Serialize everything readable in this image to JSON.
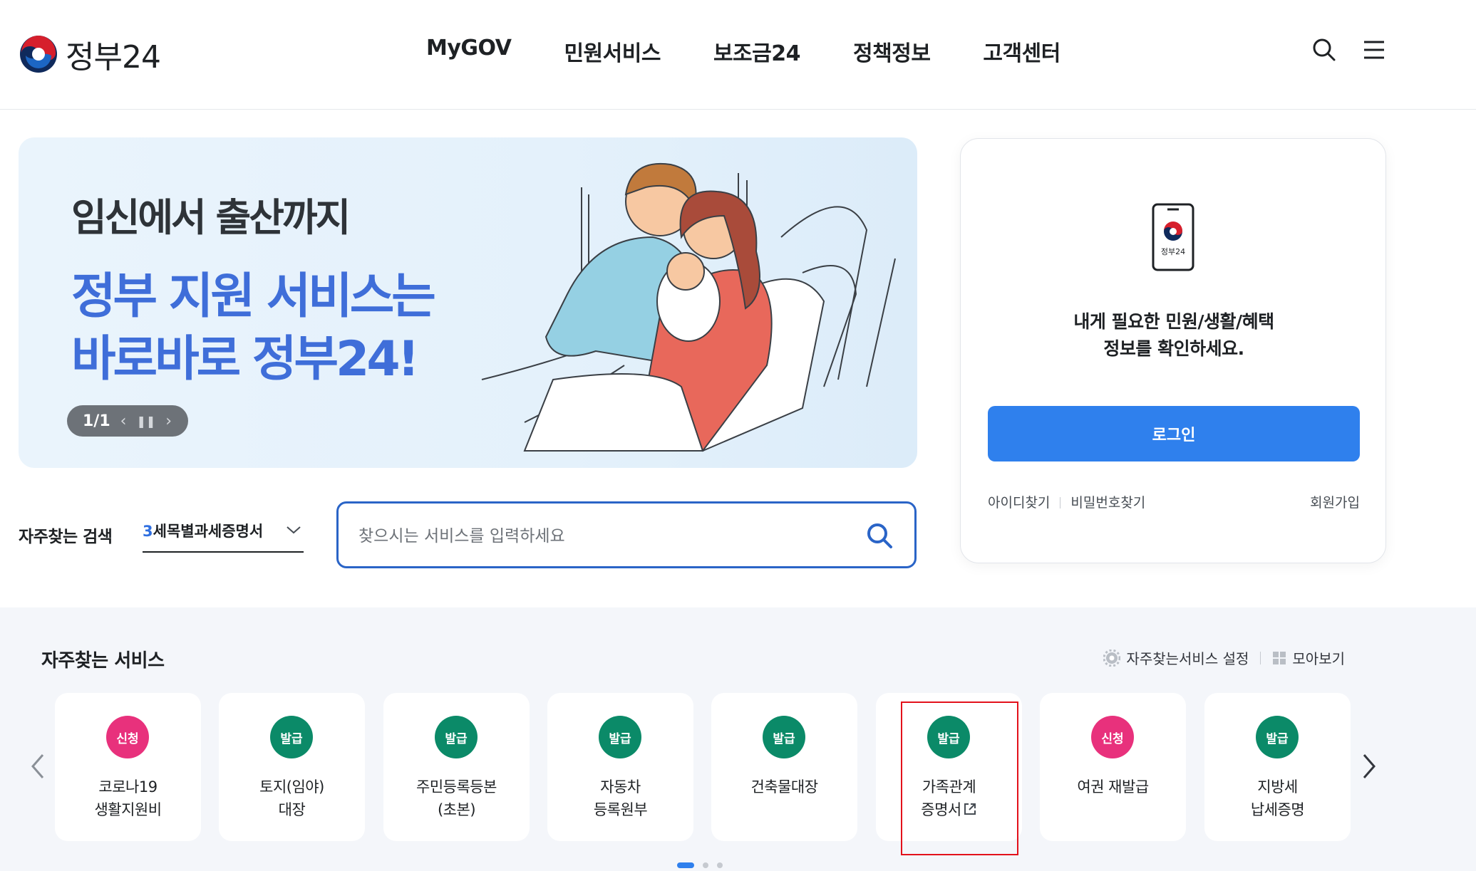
{
  "header": {
    "logo_text": "정부24",
    "nav": [
      "MyGOV",
      "민원서비스",
      "보조금24",
      "정책정보",
      "고객센터"
    ],
    "icons": [
      "search-icon",
      "menu-icon"
    ]
  },
  "banner": {
    "kicker": "임신에서 출산까지",
    "headline": "정부 지원 서비스는 바로바로 정부24!",
    "pager": "1/1"
  },
  "login": {
    "phone_label": "정부24",
    "message_line1": "내게 필요한 민원/생활/혜택",
    "message_line2": "정보를 확인하세요.",
    "button": "로그인",
    "find_id": "아이디찾기",
    "find_pw": "비밀번호찾기",
    "signup": "회원가입"
  },
  "search": {
    "fav_label": "자주찾는 검색",
    "fav_rank": "3",
    "fav_term": "세목별과세증명서",
    "placeholder": "찾으시는 서비스를 입력하세요"
  },
  "services": {
    "title": "자주찾는 서비스",
    "settings_label": "자주찾는서비스 설정",
    "viewall_label": "모아보기",
    "items": [
      {
        "badge": "신청",
        "type": "apply",
        "line1": "코로나19",
        "line2": "생활지원비"
      },
      {
        "badge": "발급",
        "type": "issue",
        "line1": "토지(임야)",
        "line2": "대장"
      },
      {
        "badge": "발급",
        "type": "issue",
        "line1": "주민등록등본",
        "line2": "(초본)"
      },
      {
        "badge": "발급",
        "type": "issue",
        "line1": "자동차",
        "line2": "등록원부"
      },
      {
        "badge": "발급",
        "type": "issue",
        "line1": "건축물대장",
        "line2": ""
      },
      {
        "badge": "발급",
        "type": "issue",
        "line1": "가족관계",
        "line2": "증명서"
      },
      {
        "badge": "신청",
        "type": "apply",
        "line1": "여권 재발급",
        "line2": ""
      },
      {
        "badge": "발급",
        "type": "issue",
        "line1": "지방세",
        "line2": "납세증명"
      }
    ],
    "carousel_page": 1,
    "carousel_pages": 3
  },
  "colors": {
    "accent_blue": "#2f80ed",
    "banner_text_blue": "#3f6ed9",
    "apply_pink": "#e8317c",
    "issue_green": "#0b8a68",
    "highlight_red": "#e3111b"
  }
}
